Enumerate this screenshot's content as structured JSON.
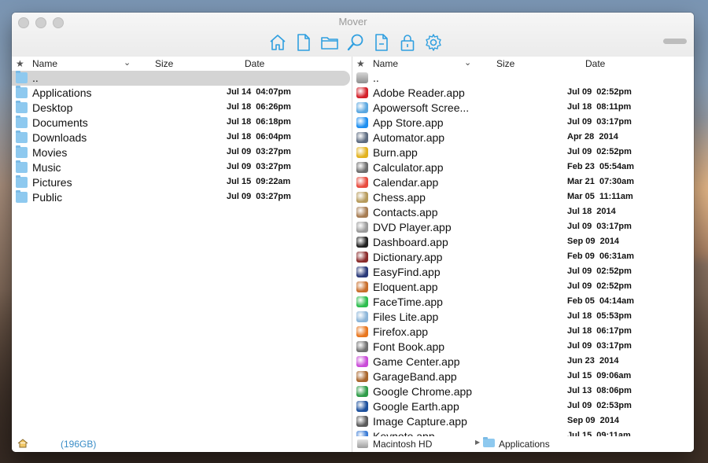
{
  "window": {
    "title": "Mover"
  },
  "toolbar": [
    {
      "name": "home-button",
      "icon": "home-icon"
    },
    {
      "name": "new-file-button",
      "icon": "file-icon"
    },
    {
      "name": "folder-button",
      "icon": "folder-icon"
    },
    {
      "name": "search-button",
      "icon": "search-icon"
    },
    {
      "name": "remove-button",
      "icon": "file-minus-icon"
    },
    {
      "name": "lock-button",
      "icon": "lock-icon"
    },
    {
      "name": "settings-button",
      "icon": "gear-icon"
    }
  ],
  "columns": {
    "name": "Name",
    "size": "Size",
    "date": "Date"
  },
  "left": {
    "parent": "..",
    "rows": [
      {
        "name": "Applications",
        "date": "Jul 14  04:07pm"
      },
      {
        "name": "Desktop",
        "date": "Jul 18  06:26pm"
      },
      {
        "name": "Documents",
        "date": "Jul 18  06:18pm"
      },
      {
        "name": "Downloads",
        "date": "Jul 18  06:04pm"
      },
      {
        "name": "Movies",
        "date": "Jul 09  03:27pm"
      },
      {
        "name": "Music",
        "date": "Jul 09  03:27pm"
      },
      {
        "name": "Pictures",
        "date": "Jul 15  09:22am"
      },
      {
        "name": "Public",
        "date": "Jul 09  03:27pm"
      }
    ],
    "status_label": "(196GB)"
  },
  "right": {
    "parent": "..",
    "rows": [
      {
        "name": "Adobe Reader.app",
        "date": "Jul 09  02:52pm",
        "color": "#d4202a"
      },
      {
        "name": "Apowersoft Scree...",
        "date": "Jul 18  08:11pm",
        "color": "#5aa7e0"
      },
      {
        "name": "App Store.app",
        "date": "Jul 09  03:17pm",
        "color": "#1e8ff0"
      },
      {
        "name": "Automator.app",
        "date": "Apr 28  2014",
        "color": "#5d6b80"
      },
      {
        "name": "Burn.app",
        "date": "Jul 09  02:52pm",
        "color": "#e2b21e"
      },
      {
        "name": "Calculator.app",
        "date": "Feb 23  05:54am",
        "color": "#6d6d6d"
      },
      {
        "name": "Calendar.app",
        "date": "Mar 21  07:30am",
        "color": "#e84a3d"
      },
      {
        "name": "Chess.app",
        "date": "Mar 05  11:11am",
        "color": "#b69a5a"
      },
      {
        "name": "Contacts.app",
        "date": "Jul 18  2014",
        "color": "#a67c52"
      },
      {
        "name": "DVD Player.app",
        "date": "Jul 09  03:17pm",
        "color": "#9a9a9a"
      },
      {
        "name": "Dashboard.app",
        "date": "Sep 09  2014",
        "color": "#222222"
      },
      {
        "name": "Dictionary.app",
        "date": "Feb 09  06:31am",
        "color": "#8a2a2a"
      },
      {
        "name": "EasyFind.app",
        "date": "Jul 09  02:52pm",
        "color": "#2a3a7a"
      },
      {
        "name": "Eloquent.app",
        "date": "Jul 09  02:52pm",
        "color": "#c86d2a"
      },
      {
        "name": "FaceTime.app",
        "date": "Feb 05  04:14am",
        "color": "#2dbd4e"
      },
      {
        "name": "Files Lite.app",
        "date": "Jul 18  05:53pm",
        "color": "#8ab4d8"
      },
      {
        "name": "Firefox.app",
        "date": "Jul 18  06:17pm",
        "color": "#e8761e"
      },
      {
        "name": "Font Book.app",
        "date": "Jul 09  03:17pm",
        "color": "#707070"
      },
      {
        "name": "Game Center.app",
        "date": "Jun 23  2014",
        "color": "#c94bd8"
      },
      {
        "name": "GarageBand.app",
        "date": "Jul 15  09:06am",
        "color": "#a8642a"
      },
      {
        "name": "Google Chrome.app",
        "date": "Jul 13  08:06pm",
        "color": "#2e9c48"
      },
      {
        "name": "Google Earth.app",
        "date": "Jul 09  02:53pm",
        "color": "#1b4f9c"
      },
      {
        "name": "Image Capture.app",
        "date": "Sep 09  2014",
        "color": "#5a5a5a"
      },
      {
        "name": "Keynote.app",
        "date": "Jul 15  09:11am",
        "color": "#3a7bd5"
      }
    ],
    "status_disk": "Macintosh HD",
    "status_folder": "Applications"
  }
}
